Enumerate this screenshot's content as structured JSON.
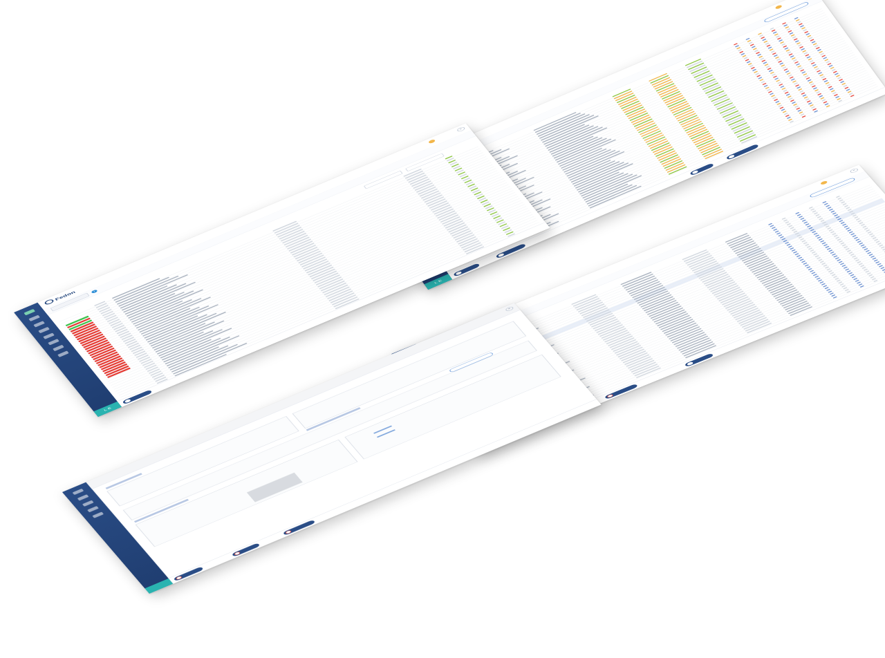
{
  "app": {
    "brand": "Fedon",
    "sidebar_footer": "L E"
  },
  "user": {
    "name": "",
    "role": ""
  },
  "windows": [
    {
      "id": "top-right",
      "title": "",
      "rows": 40,
      "buttons": [],
      "highlight_rows": []
    },
    {
      "id": "left",
      "title": "",
      "rows": 46,
      "buttons": [],
      "highlight_rows": []
    },
    {
      "id": "right",
      "title": "",
      "rows": 40,
      "buttons": [],
      "highlight_rows": [
        8,
        9
      ]
    },
    {
      "id": "bottom-left",
      "title": "",
      "rows": 0,
      "buttons": []
    }
  ],
  "colors": {
    "sidebar": "#1f3d70",
    "accent_green": "#8cc63f",
    "accent_orange": "#f0b445",
    "status_red": "#e53b34",
    "status_green": "#3dc24a",
    "teal_footer": "#2ab3b0"
  },
  "icons": [
    "home-icon",
    "dashboard-icon",
    "list-icon",
    "chart-icon",
    "settings-icon",
    "tools-icon",
    "link-icon",
    "search-icon",
    "star-icon",
    "close-icon",
    "info-icon",
    "pdf-icon"
  ]
}
